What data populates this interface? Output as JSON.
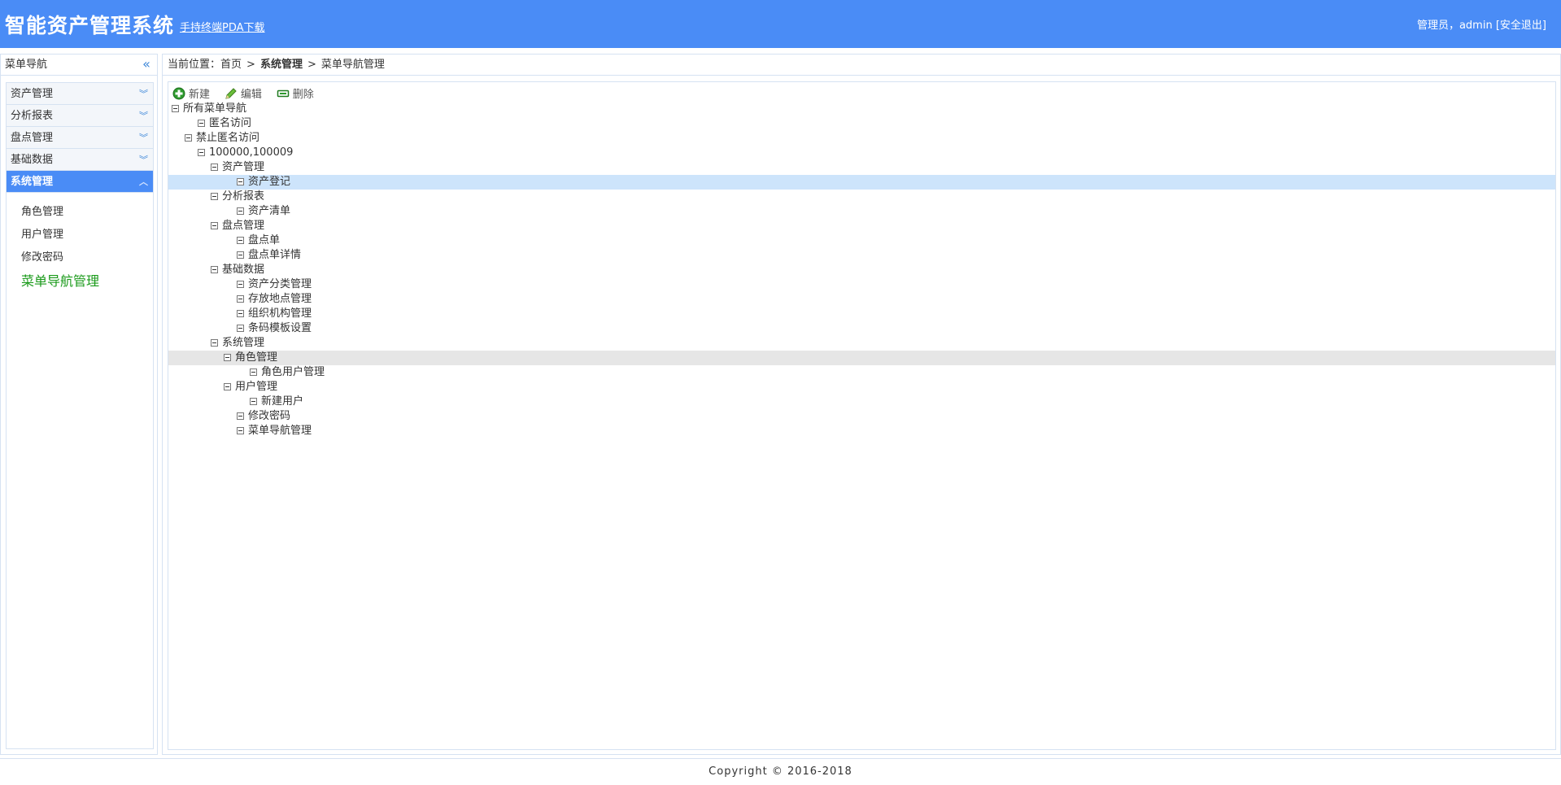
{
  "header": {
    "title": "智能资产管理系统",
    "pda_link": "手持终端PDA下载",
    "user_prefix": "管理员，admin",
    "logout": "[安全退出]"
  },
  "sidebar": {
    "title": "菜单导航",
    "collapse_icon": "double-chevron-left-icon",
    "sections": [
      {
        "label": "资产管理",
        "expanded": false
      },
      {
        "label": "分析报表",
        "expanded": false
      },
      {
        "label": "盘点管理",
        "expanded": false
      },
      {
        "label": "基础数据",
        "expanded": false
      },
      {
        "label": "系统管理",
        "expanded": true
      }
    ],
    "sub_items": [
      {
        "label": "角色管理",
        "current": false
      },
      {
        "label": "用户管理",
        "current": false
      },
      {
        "label": "修改密码",
        "current": false
      },
      {
        "label": "菜单导航管理",
        "current": true
      }
    ]
  },
  "breadcrumb": {
    "prefix": "当前位置：",
    "items": [
      "首页",
      "系统管理",
      "菜单导航管理"
    ],
    "sep": ">"
  },
  "toolbar": {
    "new_label": "新建",
    "edit_label": "编辑",
    "delete_label": "删除"
  },
  "tree": [
    {
      "label": "所有菜单导航",
      "level": 0
    },
    {
      "label": "匿名访问",
      "level": 2
    },
    {
      "label": "禁止匿名访问",
      "level": 1
    },
    {
      "label": "100000,100009",
      "level": 2
    },
    {
      "label": "资产管理",
      "level": 3
    },
    {
      "label": "资产登记",
      "level": 5,
      "state": "selected"
    },
    {
      "label": "分析报表",
      "level": 3
    },
    {
      "label": "资产清单",
      "level": 5
    },
    {
      "label": "盘点管理",
      "level": 3
    },
    {
      "label": "盘点单",
      "level": 5
    },
    {
      "label": "盘点单详情",
      "level": 5
    },
    {
      "label": "基础数据",
      "level": 3
    },
    {
      "label": "资产分类管理",
      "level": 5
    },
    {
      "label": "存放地点管理",
      "level": 5
    },
    {
      "label": "组织机构管理",
      "level": 5
    },
    {
      "label": "条码模板设置",
      "level": 5
    },
    {
      "label": "系统管理",
      "level": 3
    },
    {
      "label": "角色管理",
      "level": 4,
      "state": "hover"
    },
    {
      "label": "角色用户管理",
      "level": 6
    },
    {
      "label": "用户管理",
      "level": 4
    },
    {
      "label": "新建用户",
      "level": 6
    },
    {
      "label": "修改密码",
      "level": 5
    },
    {
      "label": "菜单导航管理",
      "level": 5
    }
  ],
  "footer": {
    "copyright": "Copyright © 2016-2018"
  },
  "colors": {
    "header_bg": "#4a8cf6",
    "selected_row": "#cde4fb",
    "current_menu": "#1a9a1a"
  }
}
